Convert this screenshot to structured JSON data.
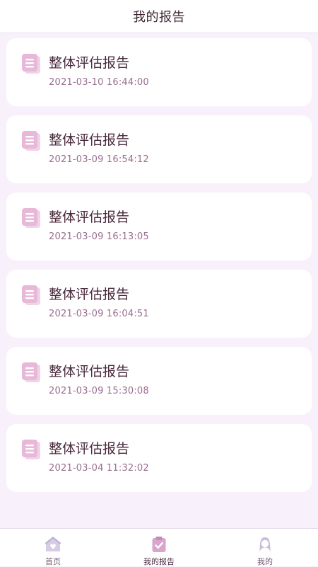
{
  "header": {
    "title": "我的报告"
  },
  "reports": [
    {
      "title": "整体评估报告",
      "date": "2021-03-10 16:44:00"
    },
    {
      "title": "整体评估报告",
      "date": "2021-03-09 16:54:12"
    },
    {
      "title": "整体评估报告",
      "date": "2021-03-09 16:13:05"
    },
    {
      "title": "整体评估报告",
      "date": "2021-03-09 16:04:51"
    },
    {
      "title": "整体评估报告",
      "date": "2021-03-09 15:30:08"
    },
    {
      "title": "整体评估报告",
      "date": "2021-03-04 11:32:02"
    }
  ],
  "tabbar": {
    "tabs": [
      {
        "label": "首页",
        "icon": "home-icon"
      },
      {
        "label": "我的报告",
        "icon": "report-clipboard-icon",
        "active": true
      },
      {
        "label": "我的",
        "icon": "profile-icon"
      }
    ]
  },
  "colors": {
    "accent": "#e8b8d8",
    "page_bg": "#f8f1fb",
    "card_bg": "#ffffff",
    "title_text": "#4a2a3c",
    "date_text": "#9a6d8f"
  }
}
